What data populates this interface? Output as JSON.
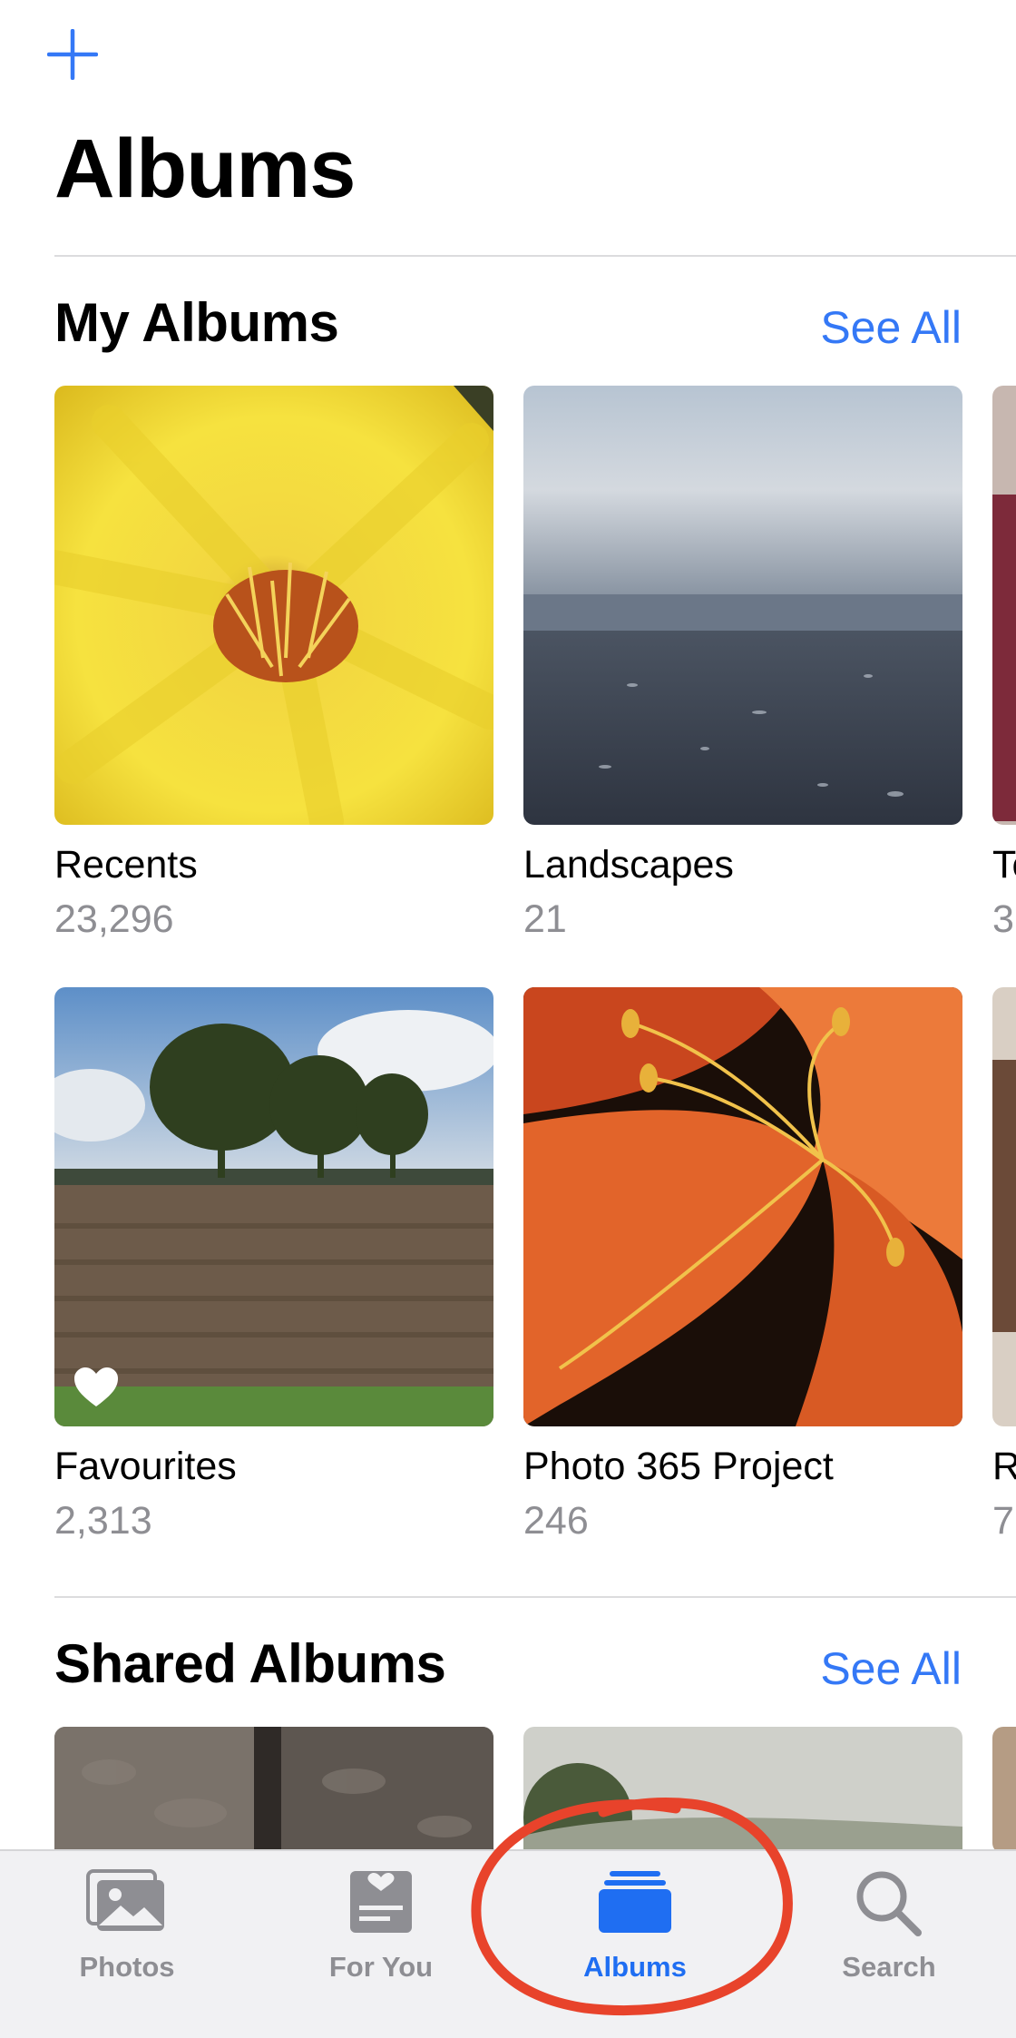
{
  "header": {
    "title": "Albums"
  },
  "my_albums": {
    "title": "My Albums",
    "see_all": "See All",
    "items": [
      {
        "name": "Recents",
        "count": "23,296"
      },
      {
        "name": "Landscapes",
        "count": "21"
      },
      {
        "name": "Te",
        "count": "3"
      },
      {
        "name": "Favourites",
        "count": "2,313"
      },
      {
        "name": "Photo 365 Project",
        "count": "246"
      },
      {
        "name": "R",
        "count": "7"
      }
    ]
  },
  "shared_albums": {
    "title": "Shared Albums",
    "see_all": "See All"
  },
  "tabbar": {
    "tabs": [
      {
        "label": "Photos",
        "icon": "photos-icon",
        "active": false
      },
      {
        "label": "For You",
        "icon": "for-you-icon",
        "active": false
      },
      {
        "label": "Albums",
        "icon": "albums-icon",
        "active": true
      },
      {
        "label": "Search",
        "icon": "search-icon",
        "active": false
      }
    ]
  },
  "colors": {
    "accent": "#3478f6",
    "annotation": "#e8432b"
  }
}
